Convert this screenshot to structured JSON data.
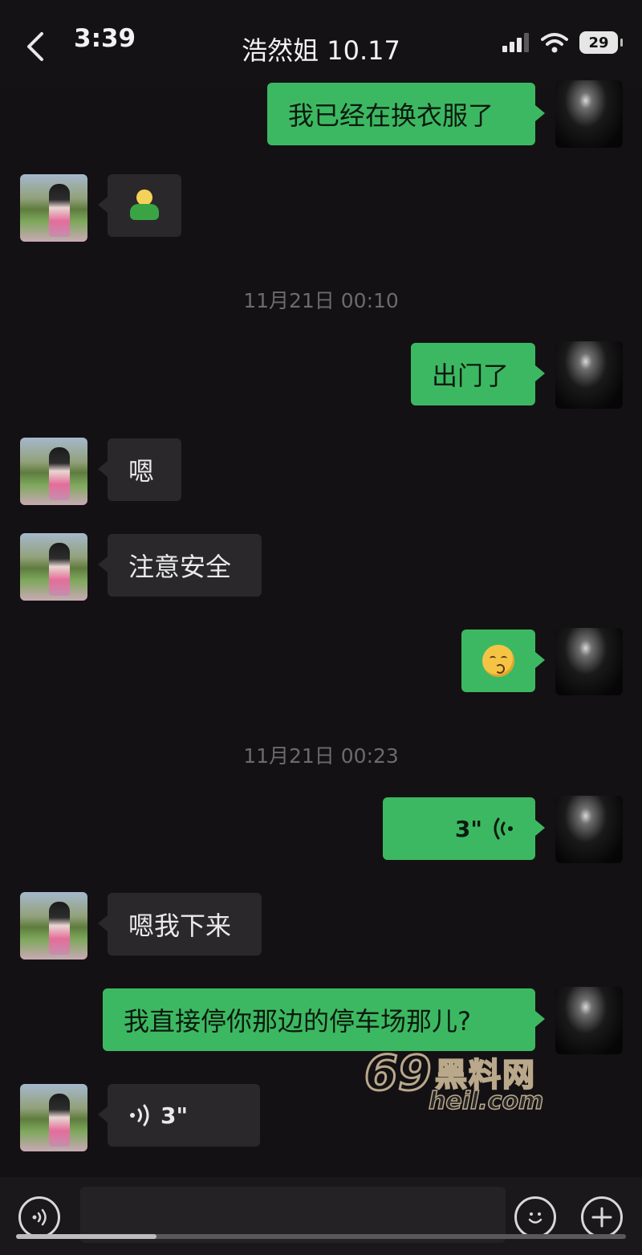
{
  "header": {
    "time": "3:39",
    "title": "浩然姐 10.17",
    "battery": "29"
  },
  "messages": [
    {
      "side": "out",
      "kind": "text",
      "text": "我已经在换衣服了"
    },
    {
      "side": "in",
      "kind": "emoji",
      "emoji": "person-emoji"
    },
    {
      "kind": "timestamp",
      "text": "11月21日 00:10"
    },
    {
      "side": "out",
      "kind": "text",
      "text": "出门了"
    },
    {
      "side": "in",
      "kind": "text",
      "text": "嗯"
    },
    {
      "side": "in",
      "kind": "text",
      "text": "注意安全"
    },
    {
      "side": "out",
      "kind": "emoji",
      "emoji": "kissing-face-emoji"
    },
    {
      "kind": "timestamp",
      "text": "11月21日 00:23"
    },
    {
      "side": "out",
      "kind": "voice",
      "duration": "3\""
    },
    {
      "side": "in",
      "kind": "text",
      "text": "嗯我下来"
    },
    {
      "side": "out",
      "kind": "text",
      "text": "我直接停你那边的停车场那儿?"
    },
    {
      "side": "in",
      "kind": "voice",
      "duration": "3\""
    }
  ],
  "watermark": {
    "number": "69",
    "cn": "黑料网",
    "url": "heil.com"
  },
  "colors": {
    "background": "#141114",
    "incoming_bubble": "#2a282b",
    "outgoing_bubble": "#3db862",
    "timestamp": "#6c6a6d"
  },
  "icons": [
    "back-chevron-icon",
    "signal-icon",
    "wifi-icon",
    "battery-icon",
    "voice-input-icon",
    "emoji-icon",
    "plus-icon"
  ]
}
